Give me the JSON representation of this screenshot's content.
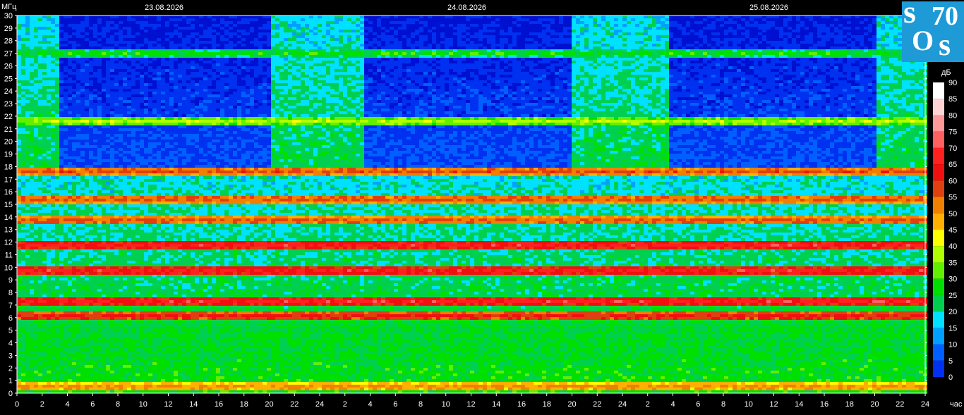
{
  "logo": {
    "l1": "s",
    "l2": "70",
    "l3": "O",
    "l4": "s"
  },
  "colors": {
    "background": "#000000",
    "text": "#ffffff",
    "logo_bg": "#1e9ad6"
  },
  "chart_data": {
    "type": "heatmap",
    "title": "",
    "y_unit_label": "МГц",
    "x_unit_label": "час",
    "colorbar_unit_label": "дБ",
    "dates": [
      "23.08.2026",
      "24.08.2026",
      "25.08.2026"
    ],
    "ylim": [
      0,
      30
    ],
    "y_ticks": [
      "0",
      "1",
      "2",
      "3",
      "4",
      "5",
      "6",
      "7",
      "8",
      "9",
      "10",
      "11",
      "12",
      "13",
      "14",
      "15",
      "16",
      "17",
      "18",
      "19",
      "20",
      "21",
      "22",
      "23",
      "24",
      "25",
      "26",
      "27",
      "28",
      "29",
      "30"
    ],
    "xlim_hours": [
      0,
      72
    ],
    "x_ticks": [
      "0",
      "2",
      "4",
      "6",
      "8",
      "10",
      "12",
      "14",
      "16",
      "18",
      "20",
      "22",
      "24",
      "2",
      "4",
      "6",
      "8",
      "10",
      "12",
      "14",
      "16",
      "18",
      "20",
      "22",
      "24",
      "2",
      "4",
      "6",
      "8",
      "10",
      "12",
      "14",
      "16",
      "18",
      "20",
      "22",
      "24"
    ],
    "colorbar_ticks": [
      "90",
      "85",
      "80",
      "75",
      "70",
      "65",
      "60",
      "55",
      "50",
      "45",
      "40",
      "35",
      "30",
      "25",
      "20",
      "15",
      "10",
      "5",
      "0"
    ],
    "colorbar_range": [
      0,
      90
    ],
    "colorbar_colors": [
      "#ffffff",
      "#ffd4d4",
      "#ff9898",
      "#ff6060",
      "#ff2020",
      "#f01010",
      "#e04010",
      "#f08000",
      "#ffb000",
      "#ffff00",
      "#b0ff00",
      "#60f000",
      "#00e000",
      "#00d050",
      "#00e0ff",
      "#00a0ff",
      "#0060ff",
      "#0030f0",
      "#0010d0"
    ],
    "band_levels_db": [
      {
        "mhz": 0.5,
        "db": 55
      },
      {
        "mhz": 6.1,
        "db": 65
      },
      {
        "mhz": 7.3,
        "db": 70
      },
      {
        "mhz": 9.7,
        "db": 70
      },
      {
        "mhz": 11.8,
        "db": 70
      },
      {
        "mhz": 13.7,
        "db": 60
      },
      {
        "mhz": 15.4,
        "db": 60
      },
      {
        "mhz": 17.6,
        "db": 60
      },
      {
        "mhz": 21.6,
        "db": 40
      },
      {
        "mhz": 27.0,
        "db": 30
      }
    ]
  }
}
